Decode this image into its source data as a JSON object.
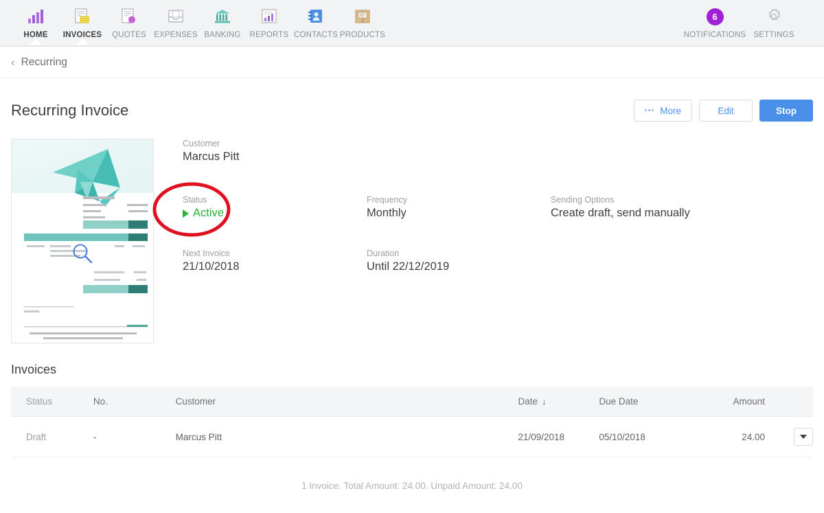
{
  "nav": {
    "items": [
      {
        "label": "HOME",
        "icon": "bar-chart-icon",
        "active": true
      },
      {
        "label": "INVOICES",
        "icon": "invoice-doc-icon",
        "active": true
      },
      {
        "label": "QUOTES",
        "icon": "quote-doc-icon",
        "active": false
      },
      {
        "label": "EXPENSES",
        "icon": "expense-tray-icon",
        "active": false
      },
      {
        "label": "BANKING",
        "icon": "bank-icon",
        "active": false
      },
      {
        "label": "REPORTS",
        "icon": "report-chart-icon",
        "active": false
      },
      {
        "label": "CONTACTS",
        "icon": "address-book-icon",
        "active": false
      },
      {
        "label": "PRODUCTS",
        "icon": "product-box-icon",
        "active": false
      }
    ],
    "notifications": {
      "label": "NOTIFICATIONS",
      "count": "6",
      "badge_color": "#a020d8"
    },
    "settings": {
      "label": "SETTINGS",
      "icon": "gear-icon"
    }
  },
  "breadcrumb": {
    "back_label": "Recurring",
    "chevron": "‹"
  },
  "page": {
    "title": "Recurring Invoice"
  },
  "toolbar": {
    "more_label": "More",
    "more_dots": "•••",
    "edit_label": "Edit",
    "stop_label": "Stop",
    "primary_color": "#4a90e8"
  },
  "preview": {
    "name": "invoice-thumbnail",
    "magnifier": "search-icon"
  },
  "details": {
    "customer": {
      "label": "Customer",
      "value": "Marcus Pitt"
    },
    "status": {
      "label": "Status",
      "value": "Active",
      "color": "#29b33a"
    },
    "frequency": {
      "label": "Frequency",
      "value": "Monthly"
    },
    "sending_options": {
      "label": "Sending Options",
      "value": "Create draft, send manually"
    },
    "next_invoice": {
      "label": "Next Invoice",
      "value": "21/10/2018"
    },
    "duration": {
      "label": "Duration",
      "value": "Until 22/12/2019"
    }
  },
  "annotation": {
    "shape": "red-ellipse-highlight",
    "color": "#e01020",
    "target": "status-field"
  },
  "invoices": {
    "section_title": "Invoices",
    "columns": [
      "Status",
      "No.",
      "Customer",
      "Date",
      "Due Date",
      "Amount",
      ""
    ],
    "sort": {
      "column": "Date",
      "arrow": "↓"
    },
    "rows": [
      {
        "status": "Draft",
        "no": "-",
        "customer": "Marcus Pitt",
        "date": "21/09/2018",
        "due_date": "05/10/2018",
        "amount": "24.00",
        "action": "row-menu-caret"
      }
    ],
    "summary": "1 Invoice. Total Amount: 24.00. Unpaid Amount: 24.00"
  }
}
